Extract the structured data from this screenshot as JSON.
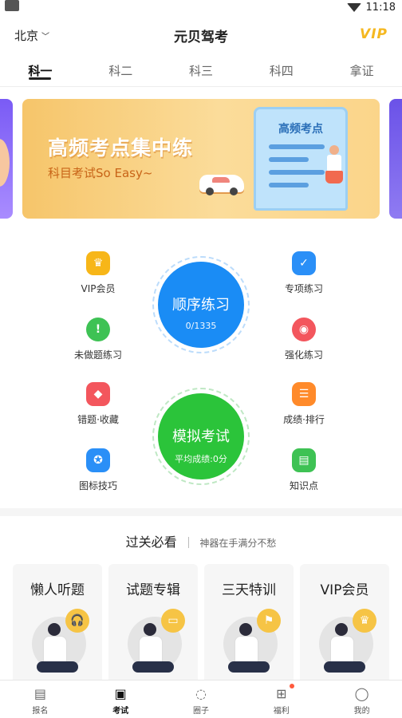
{
  "status_bar": {
    "time": "11:18"
  },
  "header": {
    "city": "北京",
    "title": "元贝驾考",
    "vip": "VIP"
  },
  "tabs": [
    {
      "label": "科一",
      "active": true
    },
    {
      "label": "科二",
      "active": false
    },
    {
      "label": "科三",
      "active": false
    },
    {
      "label": "科四",
      "active": false
    },
    {
      "label": "拿证",
      "active": false
    }
  ],
  "banner": {
    "title": "高频考点集中练",
    "subtitle": "科目考试So Easy~",
    "scroll_title": "高频考点"
  },
  "features": {
    "left": [
      {
        "label": "VIP会员",
        "icon": "crown-icon",
        "color": "#f7b618"
      },
      {
        "label": "未做题练习",
        "icon": "alert-icon",
        "color": "#3ec254"
      },
      {
        "label": "错题·收藏",
        "icon": "tag-icon",
        "color": "#f3565d"
      },
      {
        "label": "图标技巧",
        "icon": "sign-icon",
        "color": "#2a8ff7"
      }
    ],
    "right": [
      {
        "label": "专项练习",
        "icon": "checklist-icon",
        "color": "#2a8ff7"
      },
      {
        "label": "强化练习",
        "icon": "target-icon",
        "color": "#f3565d"
      },
      {
        "label": "成绩·排行",
        "icon": "list-icon",
        "color": "#ff8a2a"
      },
      {
        "label": "知识点",
        "icon": "book-icon",
        "color": "#3ec254"
      }
    ]
  },
  "sequence_practice": {
    "label": "顺序练习",
    "progress": "0/1335",
    "color": "#1a8cf5"
  },
  "mock_exam": {
    "label": "模拟考试",
    "score": "平均成绩:0分",
    "color": "#2bc43a"
  },
  "section": {
    "title": "过关必看",
    "subtitle": "神器在手满分不愁"
  },
  "cards": [
    {
      "title": "懒人听题",
      "badge": "headphones-icon"
    },
    {
      "title": "试题专辑",
      "badge": "car-icon"
    },
    {
      "title": "三天特训",
      "badge": "flag-icon"
    },
    {
      "title": "VIP会员",
      "badge": "crown-icon"
    }
  ],
  "bottom_nav": [
    {
      "label": "报名",
      "icon": "form-icon",
      "active": false,
      "dot": false
    },
    {
      "label": "考试",
      "icon": "wallet-icon",
      "active": true,
      "dot": false
    },
    {
      "label": "圈子",
      "icon": "chat-icon",
      "active": false,
      "dot": false
    },
    {
      "label": "福利",
      "icon": "gift-icon",
      "active": false,
      "dot": true
    },
    {
      "label": "我的",
      "icon": "profile-icon",
      "active": false,
      "dot": false
    }
  ]
}
